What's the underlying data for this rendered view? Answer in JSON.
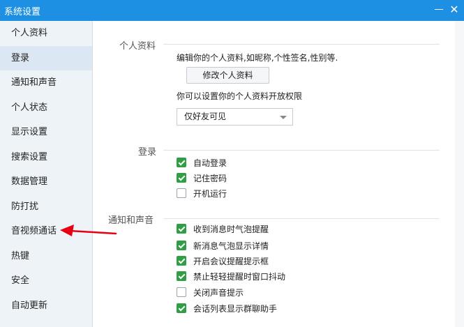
{
  "window": {
    "title": "系统设置",
    "minimize_icon": "minimize-icon",
    "close_icon": "close-icon",
    "close_glyph": "✕"
  },
  "sidebar": {
    "items": [
      {
        "label": "个人资料"
      },
      {
        "label": "登录"
      },
      {
        "label": "通知和声音"
      },
      {
        "label": "个人状态"
      },
      {
        "label": "显示设置"
      },
      {
        "label": "搜索设置"
      },
      {
        "label": "数据管理"
      },
      {
        "label": "防打扰"
      },
      {
        "label": "音视频通话"
      },
      {
        "label": "热键"
      },
      {
        "label": "安全"
      },
      {
        "label": "自动更新"
      }
    ],
    "selected_label": "登录"
  },
  "profile": {
    "section_title": "个人资料",
    "description": "编辑你的个人资料,如昵称,个性签名,性别等.",
    "edit_button": "修改个人资料",
    "permission_text": "你可以设置你的个人资料开放权限",
    "visibility_select": "仅好友可见"
  },
  "login": {
    "section_title": "登录",
    "options": [
      {
        "label": "自动登录",
        "checked": true
      },
      {
        "label": "记住密码",
        "checked": true
      },
      {
        "label": "开机运行",
        "checked": false
      }
    ]
  },
  "notify": {
    "section_title": "通知和声音",
    "options": [
      {
        "label": "收到消息时气泡提醒",
        "checked": true
      },
      {
        "label": "新消息气泡显示详情",
        "checked": true
      },
      {
        "label": "开启会议提醒提示框",
        "checked": true
      },
      {
        "label": "禁止轻轻提醒时窗口抖动",
        "checked": true
      },
      {
        "label": "关闭声音提示",
        "checked": false
      },
      {
        "label": "会话列表显示群聊助手",
        "checked": true
      }
    ]
  },
  "annotation": {
    "color": "#e60012"
  },
  "colors": {
    "titlebar": "#1e90e3",
    "check": "#2f9e44"
  }
}
